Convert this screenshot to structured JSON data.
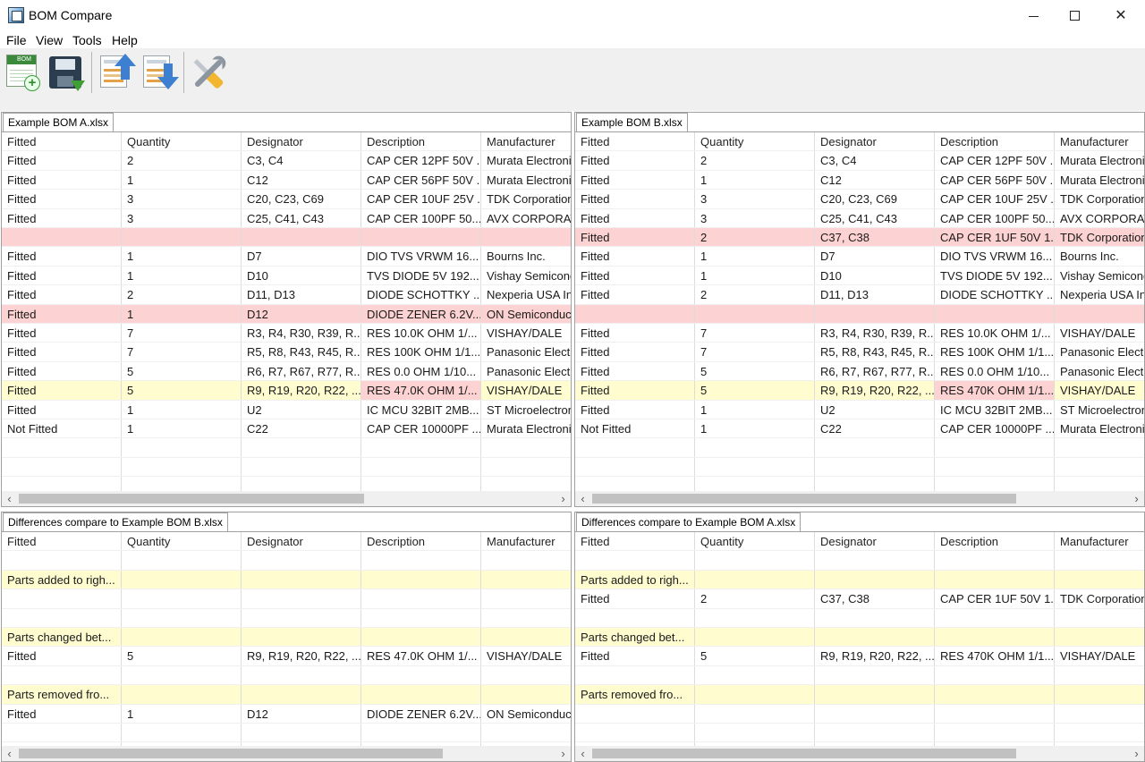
{
  "window": {
    "title": "BOM Compare",
    "minimize_icon": "minimize-icon",
    "maximize_icon": "maximize-icon",
    "close_icon": "close-icon",
    "close_glyph": "✕"
  },
  "menu": [
    "File",
    "View",
    "Tools",
    "Help"
  ],
  "toolbar": {
    "new_bom_badge": "BOM",
    "buttons": [
      "new-bom-icon",
      "save-icon",
      "move-up-icon",
      "move-down-icon",
      "tools-icon"
    ]
  },
  "columns": [
    "Fitted",
    "Quantity",
    "Designator",
    "Description",
    "Manufacturer"
  ],
  "colors": {
    "removed_row": "#fdd2d2",
    "changed_row": "#fffdd0",
    "section_row": "#fffdd0"
  },
  "scroll_arrows": {
    "left": "‹",
    "right": "›"
  },
  "bom_a": {
    "tab": "Example BOM A.xlsx",
    "rows": [
      {
        "cells": [
          "Fitted",
          "2",
          "C3, C4",
          "CAP CER 12PF 50V ...",
          "Murata Electronics"
        ],
        "state": ""
      },
      {
        "cells": [
          "Fitted",
          "1",
          "C12",
          "CAP CER 56PF 50V ...",
          "Murata Electronics"
        ],
        "state": ""
      },
      {
        "cells": [
          "Fitted",
          "3",
          "C20, C23, C69",
          "CAP CER 10UF 25V ...",
          "TDK Corporation"
        ],
        "state": ""
      },
      {
        "cells": [
          "Fitted",
          "3",
          "C25, C41, C43",
          "CAP CER 100PF 50...",
          "AVX CORPORATION"
        ],
        "state": ""
      },
      {
        "cells": [
          "",
          "",
          "",
          "",
          ""
        ],
        "state": "removed"
      },
      {
        "cells": [
          "Fitted",
          "1",
          "D7",
          "DIO TVS VRWM 16...",
          "Bourns Inc."
        ],
        "state": ""
      },
      {
        "cells": [
          "Fitted",
          "1",
          "D10",
          "TVS DIODE 5V 192...",
          "Vishay Semiconductor"
        ],
        "state": ""
      },
      {
        "cells": [
          "Fitted",
          "2",
          "D11, D13",
          "DIODE SCHOTTKY ...",
          "Nexperia USA Inc."
        ],
        "state": ""
      },
      {
        "cells": [
          "Fitted",
          "1",
          "D12",
          "DIODE ZENER 6.2V...",
          "ON Semiconductor"
        ],
        "state": "removed"
      },
      {
        "cells": [
          "Fitted",
          "7",
          "R3, R4, R30, R39, R...",
          "RES 10.0K OHM 1/...",
          "VISHAY/DALE"
        ],
        "state": ""
      },
      {
        "cells": [
          "Fitted",
          "7",
          "R5, R8, R43, R45, R...",
          "RES 100K OHM 1/1...",
          "Panasonic Electronic"
        ],
        "state": ""
      },
      {
        "cells": [
          "Fitted",
          "5",
          "R6, R7, R67, R77, R...",
          "RES 0.0 OHM 1/10...",
          "Panasonic Electronic"
        ],
        "state": ""
      },
      {
        "cells": [
          "Fitted",
          "5",
          "R9, R19, R20, R22, ...",
          "RES 47.0K OHM 1/...",
          "VISHAY/DALE"
        ],
        "state": "changed"
      },
      {
        "cells": [
          "Fitted",
          "1",
          "U2",
          "IC MCU 32BIT 2MB...",
          "ST Microelectronics"
        ],
        "state": ""
      },
      {
        "cells": [
          "Not Fitted",
          "1",
          "C22",
          "CAP CER 10000PF ...",
          "Murata Electronics"
        ],
        "state": ""
      }
    ]
  },
  "bom_b": {
    "tab": "Example BOM B.xlsx",
    "rows": [
      {
        "cells": [
          "Fitted",
          "2",
          "C3, C4",
          "CAP CER 12PF 50V ...",
          "Murata Electronics"
        ],
        "state": ""
      },
      {
        "cells": [
          "Fitted",
          "1",
          "C12",
          "CAP CER 56PF 50V ...",
          "Murata Electronics"
        ],
        "state": ""
      },
      {
        "cells": [
          "Fitted",
          "3",
          "C20, C23, C69",
          "CAP CER 10UF 25V ...",
          "TDK Corporation"
        ],
        "state": ""
      },
      {
        "cells": [
          "Fitted",
          "3",
          "C25, C41, C43",
          "CAP CER 100PF 50...",
          "AVX CORPORATION"
        ],
        "state": ""
      },
      {
        "cells": [
          "Fitted",
          "2",
          "C37, C38",
          "CAP CER 1UF 50V 1...",
          "TDK Corporation"
        ],
        "state": "removed"
      },
      {
        "cells": [
          "Fitted",
          "1",
          "D7",
          "DIO TVS VRWM 16...",
          "Bourns Inc."
        ],
        "state": ""
      },
      {
        "cells": [
          "Fitted",
          "1",
          "D10",
          "TVS DIODE 5V 192...",
          "Vishay Semiconductor"
        ],
        "state": ""
      },
      {
        "cells": [
          "Fitted",
          "2",
          "D11, D13",
          "DIODE SCHOTTKY ...",
          "Nexperia USA Inc."
        ],
        "state": ""
      },
      {
        "cells": [
          "",
          "",
          "",
          "",
          ""
        ],
        "state": "removed"
      },
      {
        "cells": [
          "Fitted",
          "7",
          "R3, R4, R30, R39, R...",
          "RES 10.0K OHM 1/...",
          "VISHAY/DALE"
        ],
        "state": ""
      },
      {
        "cells": [
          "Fitted",
          "7",
          "R5, R8, R43, R45, R...",
          "RES 100K OHM 1/1...",
          "Panasonic Electronic"
        ],
        "state": ""
      },
      {
        "cells": [
          "Fitted",
          "5",
          "R6, R7, R67, R77, R...",
          "RES 0.0 OHM 1/10...",
          "Panasonic Electronic"
        ],
        "state": ""
      },
      {
        "cells": [
          "Fitted",
          "5",
          "R9, R19, R20, R22, ...",
          "RES 470K OHM 1/1...",
          "VISHAY/DALE"
        ],
        "state": "changed"
      },
      {
        "cells": [
          "Fitted",
          "1",
          "U2",
          "IC MCU 32BIT 2MB...",
          "ST Microelectronics"
        ],
        "state": ""
      },
      {
        "cells": [
          "Not Fitted",
          "1",
          "C22",
          "CAP CER 10000PF ...",
          "Murata Electronics"
        ],
        "state": ""
      }
    ]
  },
  "diff_a": {
    "tab": "Differences compare to Example BOM B.xlsx",
    "rows": [
      {
        "cells": [
          "",
          "",
          "",
          "",
          ""
        ],
        "state": ""
      },
      {
        "cells": [
          "Parts added to righ...",
          "",
          "",
          "",
          ""
        ],
        "state": "section"
      },
      {
        "cells": [
          "",
          "",
          "",
          "",
          ""
        ],
        "state": ""
      },
      {
        "cells": [
          "",
          "",
          "",
          "",
          ""
        ],
        "state": ""
      },
      {
        "cells": [
          "Parts changed bet...",
          "",
          "",
          "",
          ""
        ],
        "state": "section"
      },
      {
        "cells": [
          "Fitted",
          "5",
          "R9, R19, R20, R22, ...",
          "RES 47.0K OHM 1/...",
          "VISHAY/DALE"
        ],
        "state": ""
      },
      {
        "cells": [
          "",
          "",
          "",
          "",
          ""
        ],
        "state": ""
      },
      {
        "cells": [
          "Parts removed fro...",
          "",
          "",
          "",
          ""
        ],
        "state": "section"
      },
      {
        "cells": [
          "Fitted",
          "1",
          "D12",
          "DIODE ZENER 6.2V...",
          "ON Semiconductor"
        ],
        "state": ""
      }
    ]
  },
  "diff_b": {
    "tab": "Differences compare to Example BOM A.xlsx",
    "rows": [
      {
        "cells": [
          "",
          "",
          "",
          "",
          ""
        ],
        "state": ""
      },
      {
        "cells": [
          "Parts added to righ...",
          "",
          "",
          "",
          ""
        ],
        "state": "section"
      },
      {
        "cells": [
          "Fitted",
          "2",
          "C37, C38",
          "CAP CER 1UF 50V 1...",
          "TDK Corporation"
        ],
        "state": ""
      },
      {
        "cells": [
          "",
          "",
          "",
          "",
          ""
        ],
        "state": ""
      },
      {
        "cells": [
          "Parts changed bet...",
          "",
          "",
          "",
          ""
        ],
        "state": "section"
      },
      {
        "cells": [
          "Fitted",
          "5",
          "R9, R19, R20, R22, ...",
          "RES 470K OHM 1/1...",
          "VISHAY/DALE"
        ],
        "state": ""
      },
      {
        "cells": [
          "",
          "",
          "",
          "",
          ""
        ],
        "state": ""
      },
      {
        "cells": [
          "Parts removed fro...",
          "",
          "",
          "",
          ""
        ],
        "state": "section"
      },
      {
        "cells": [
          "",
          "",
          "",
          "",
          ""
        ],
        "state": ""
      }
    ]
  }
}
